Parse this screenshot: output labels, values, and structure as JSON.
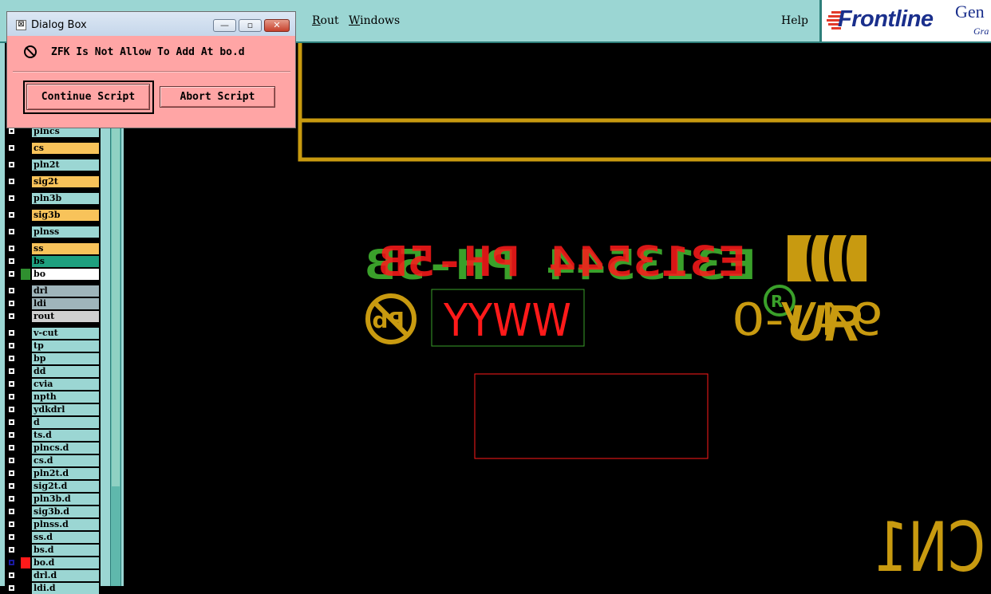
{
  "menubar": {
    "items": [
      {
        "label": "Rout",
        "underline": "R",
        "rest": "out"
      },
      {
        "label": "Windows",
        "underline": "W",
        "rest": "indows"
      },
      {
        "label": "Help",
        "underline": "",
        "rest": "Help"
      }
    ],
    "partial_item": ")",
    "logo": {
      "brand": "Frontline",
      "suffix": "Gen",
      "sub": "Gra"
    }
  },
  "dialog": {
    "title": "Dialog Box",
    "message": "ZFK Is Not Allow To Add At bo.d",
    "continue_label": "Continue Script",
    "abort_label": "Abort Script",
    "min_glyph": "—",
    "max_glyph": "▫",
    "close_glyph": "✕",
    "app_icon_glyph": "⊠"
  },
  "layers": [
    {
      "name": "plncs",
      "highlight": ""
    },
    {
      "name": "cs",
      "highlight": "#f8c35a"
    },
    {
      "name": "pln2t",
      "highlight": ""
    },
    {
      "name": "sig2t",
      "highlight": "#f8c35a"
    },
    {
      "name": "pln3b",
      "highlight": ""
    },
    {
      "name": "sig3b",
      "highlight": "#f8c35a"
    },
    {
      "name": "plnss",
      "highlight": ""
    },
    {
      "name": "ss",
      "highlight": "#f8c35a"
    },
    {
      "name": "bs",
      "highlight": "#1fa07f"
    },
    {
      "name": "bo",
      "highlight": "#ffffff",
      "swatch": "#2f8f2f"
    },
    {
      "name": "drl",
      "highlight": "#9fb5bb"
    },
    {
      "name": "ldi",
      "highlight": "#9fb5bb"
    },
    {
      "name": "rout",
      "highlight": "#d0d0d0"
    },
    {
      "name": "v-cut",
      "highlight": ""
    },
    {
      "name": "tp",
      "highlight": ""
    },
    {
      "name": "bp",
      "highlight": ""
    },
    {
      "name": "dd",
      "highlight": ""
    },
    {
      "name": "cvia",
      "highlight": ""
    },
    {
      "name": "npth",
      "highlight": ""
    },
    {
      "name": "ydkdrl",
      "highlight": ""
    },
    {
      "name": "d",
      "highlight": ""
    },
    {
      "name": "ts.d",
      "highlight": ""
    },
    {
      "name": "plncs.d",
      "highlight": ""
    },
    {
      "name": "cs.d",
      "highlight": ""
    },
    {
      "name": "pln2t.d",
      "highlight": ""
    },
    {
      "name": "sig2t.d",
      "highlight": ""
    },
    {
      "name": "pln3b.d",
      "highlight": ""
    },
    {
      "name": "sig3b.d",
      "highlight": ""
    },
    {
      "name": "plnss.d",
      "highlight": ""
    },
    {
      "name": "ss.d",
      "highlight": ""
    },
    {
      "name": "bs.d",
      "highlight": ""
    },
    {
      "name": "bo.d",
      "highlight": "",
      "swatch": "#ff1a1a",
      "active": true
    },
    {
      "name": "drl.d",
      "highlight": ""
    },
    {
      "name": "ldi.d",
      "highlight": ""
    }
  ],
  "canvas": {
    "marking_text": "E313544 PH-5B",
    "date_code": "YYWW",
    "rating": "94V-0",
    "refdes": "CN1",
    "pb_free": "Pb",
    "colors": {
      "gold": "#c89a10",
      "red": "#ff1a1a",
      "green": "#3aa02a",
      "bg": "#000000"
    }
  }
}
